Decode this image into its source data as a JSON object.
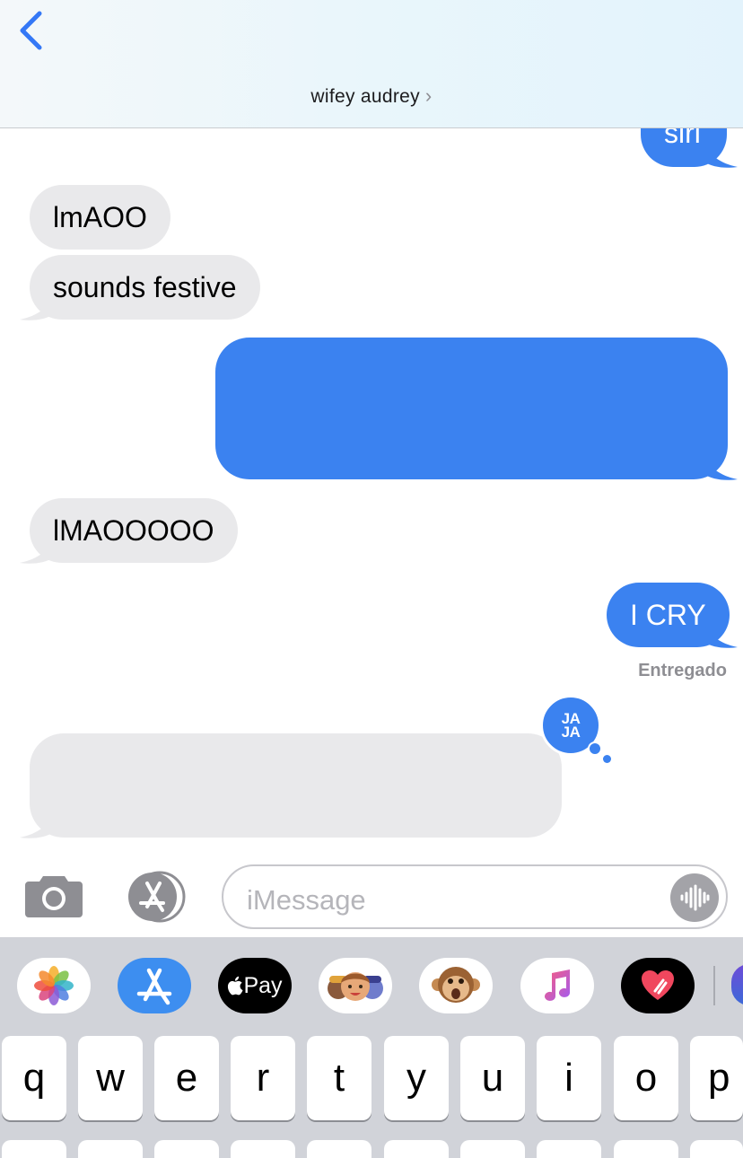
{
  "header": {
    "contact_name": "wifey audrey",
    "chevron": "›"
  },
  "messages": [
    {
      "direction": "outgoing",
      "text": "siri"
    },
    {
      "direction": "incoming",
      "text": "lmAOO"
    },
    {
      "direction": "incoming",
      "text": "sounds festive"
    },
    {
      "direction": "outgoing",
      "text": ""
    },
    {
      "direction": "incoming",
      "text": "lMAOOOOO"
    },
    {
      "direction": "outgoing",
      "text": "I CRY"
    },
    {
      "direction": "incoming",
      "text": ""
    }
  ],
  "delivery_status": "Entregado",
  "reaction": {
    "line1": "JA",
    "line2": "JA"
  },
  "input": {
    "placeholder": "iMessage"
  },
  "apps": {
    "apple_pay_label": "Pay"
  },
  "keyboard": {
    "row1": [
      "q",
      "w",
      "e",
      "r",
      "t",
      "y",
      "u",
      "i",
      "o",
      "p"
    ]
  },
  "colors": {
    "outgoing_bubble": "#3b82f0",
    "incoming_bubble": "#e9e9eb",
    "keyboard_bg": "#d1d3d9"
  }
}
